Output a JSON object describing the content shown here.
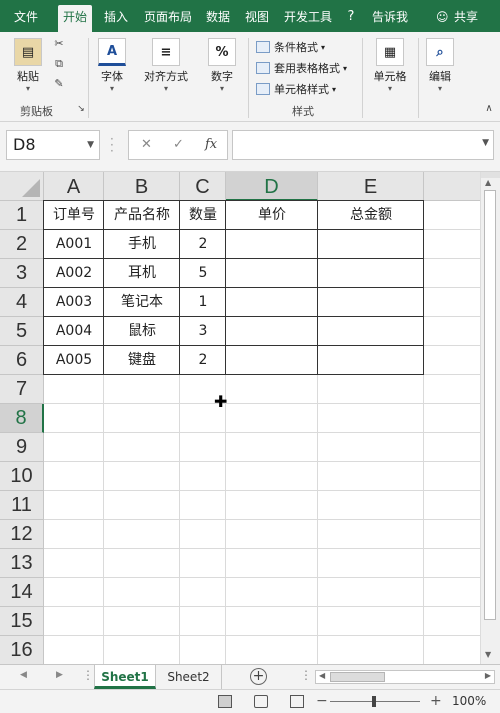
{
  "tabs": [
    "文件",
    "开始",
    "插入",
    "页面布局",
    "数据",
    "视图",
    "开发工具"
  ],
  "tell_me": "告诉我",
  "share": "共享",
  "ribbon": {
    "paste": "粘贴",
    "clipboard": "剪贴板",
    "font": "字体",
    "alignment": "对齐方式",
    "number": "数字",
    "number_symbol": "%",
    "conditional_format": "条件格式",
    "table_format": "套用表格格式",
    "cell_styles": "单元格样式",
    "styles": "样式",
    "cells": "单元格",
    "editing": "编辑"
  },
  "namebox": "D8",
  "fx_label": "fx",
  "column_headers": [
    "A",
    "B",
    "C",
    "D",
    "E"
  ],
  "selected_column": "D",
  "row_headers": [
    "1",
    "2",
    "3",
    "4",
    "5",
    "6",
    "7",
    "8",
    "9",
    "10",
    "11",
    "12",
    "13",
    "14",
    "15",
    "16"
  ],
  "selected_row": "8",
  "table": {
    "headers": [
      "订单号",
      "产品名称",
      "数量",
      "单价",
      "总金额"
    ],
    "rows": [
      [
        "A001",
        "手机",
        "2",
        "",
        ""
      ],
      [
        "A002",
        "耳机",
        "5",
        "",
        ""
      ],
      [
        "A003",
        "笔记本",
        "1",
        "",
        ""
      ],
      [
        "A004",
        "鼠标",
        "3",
        "",
        ""
      ],
      [
        "A005",
        "键盘",
        "2",
        "",
        ""
      ]
    ]
  },
  "sheets": [
    "Sheet1",
    "Sheet2"
  ],
  "active_sheet": "Sheet1",
  "zoom": "100%",
  "colors": {
    "accent": "#217346"
  }
}
